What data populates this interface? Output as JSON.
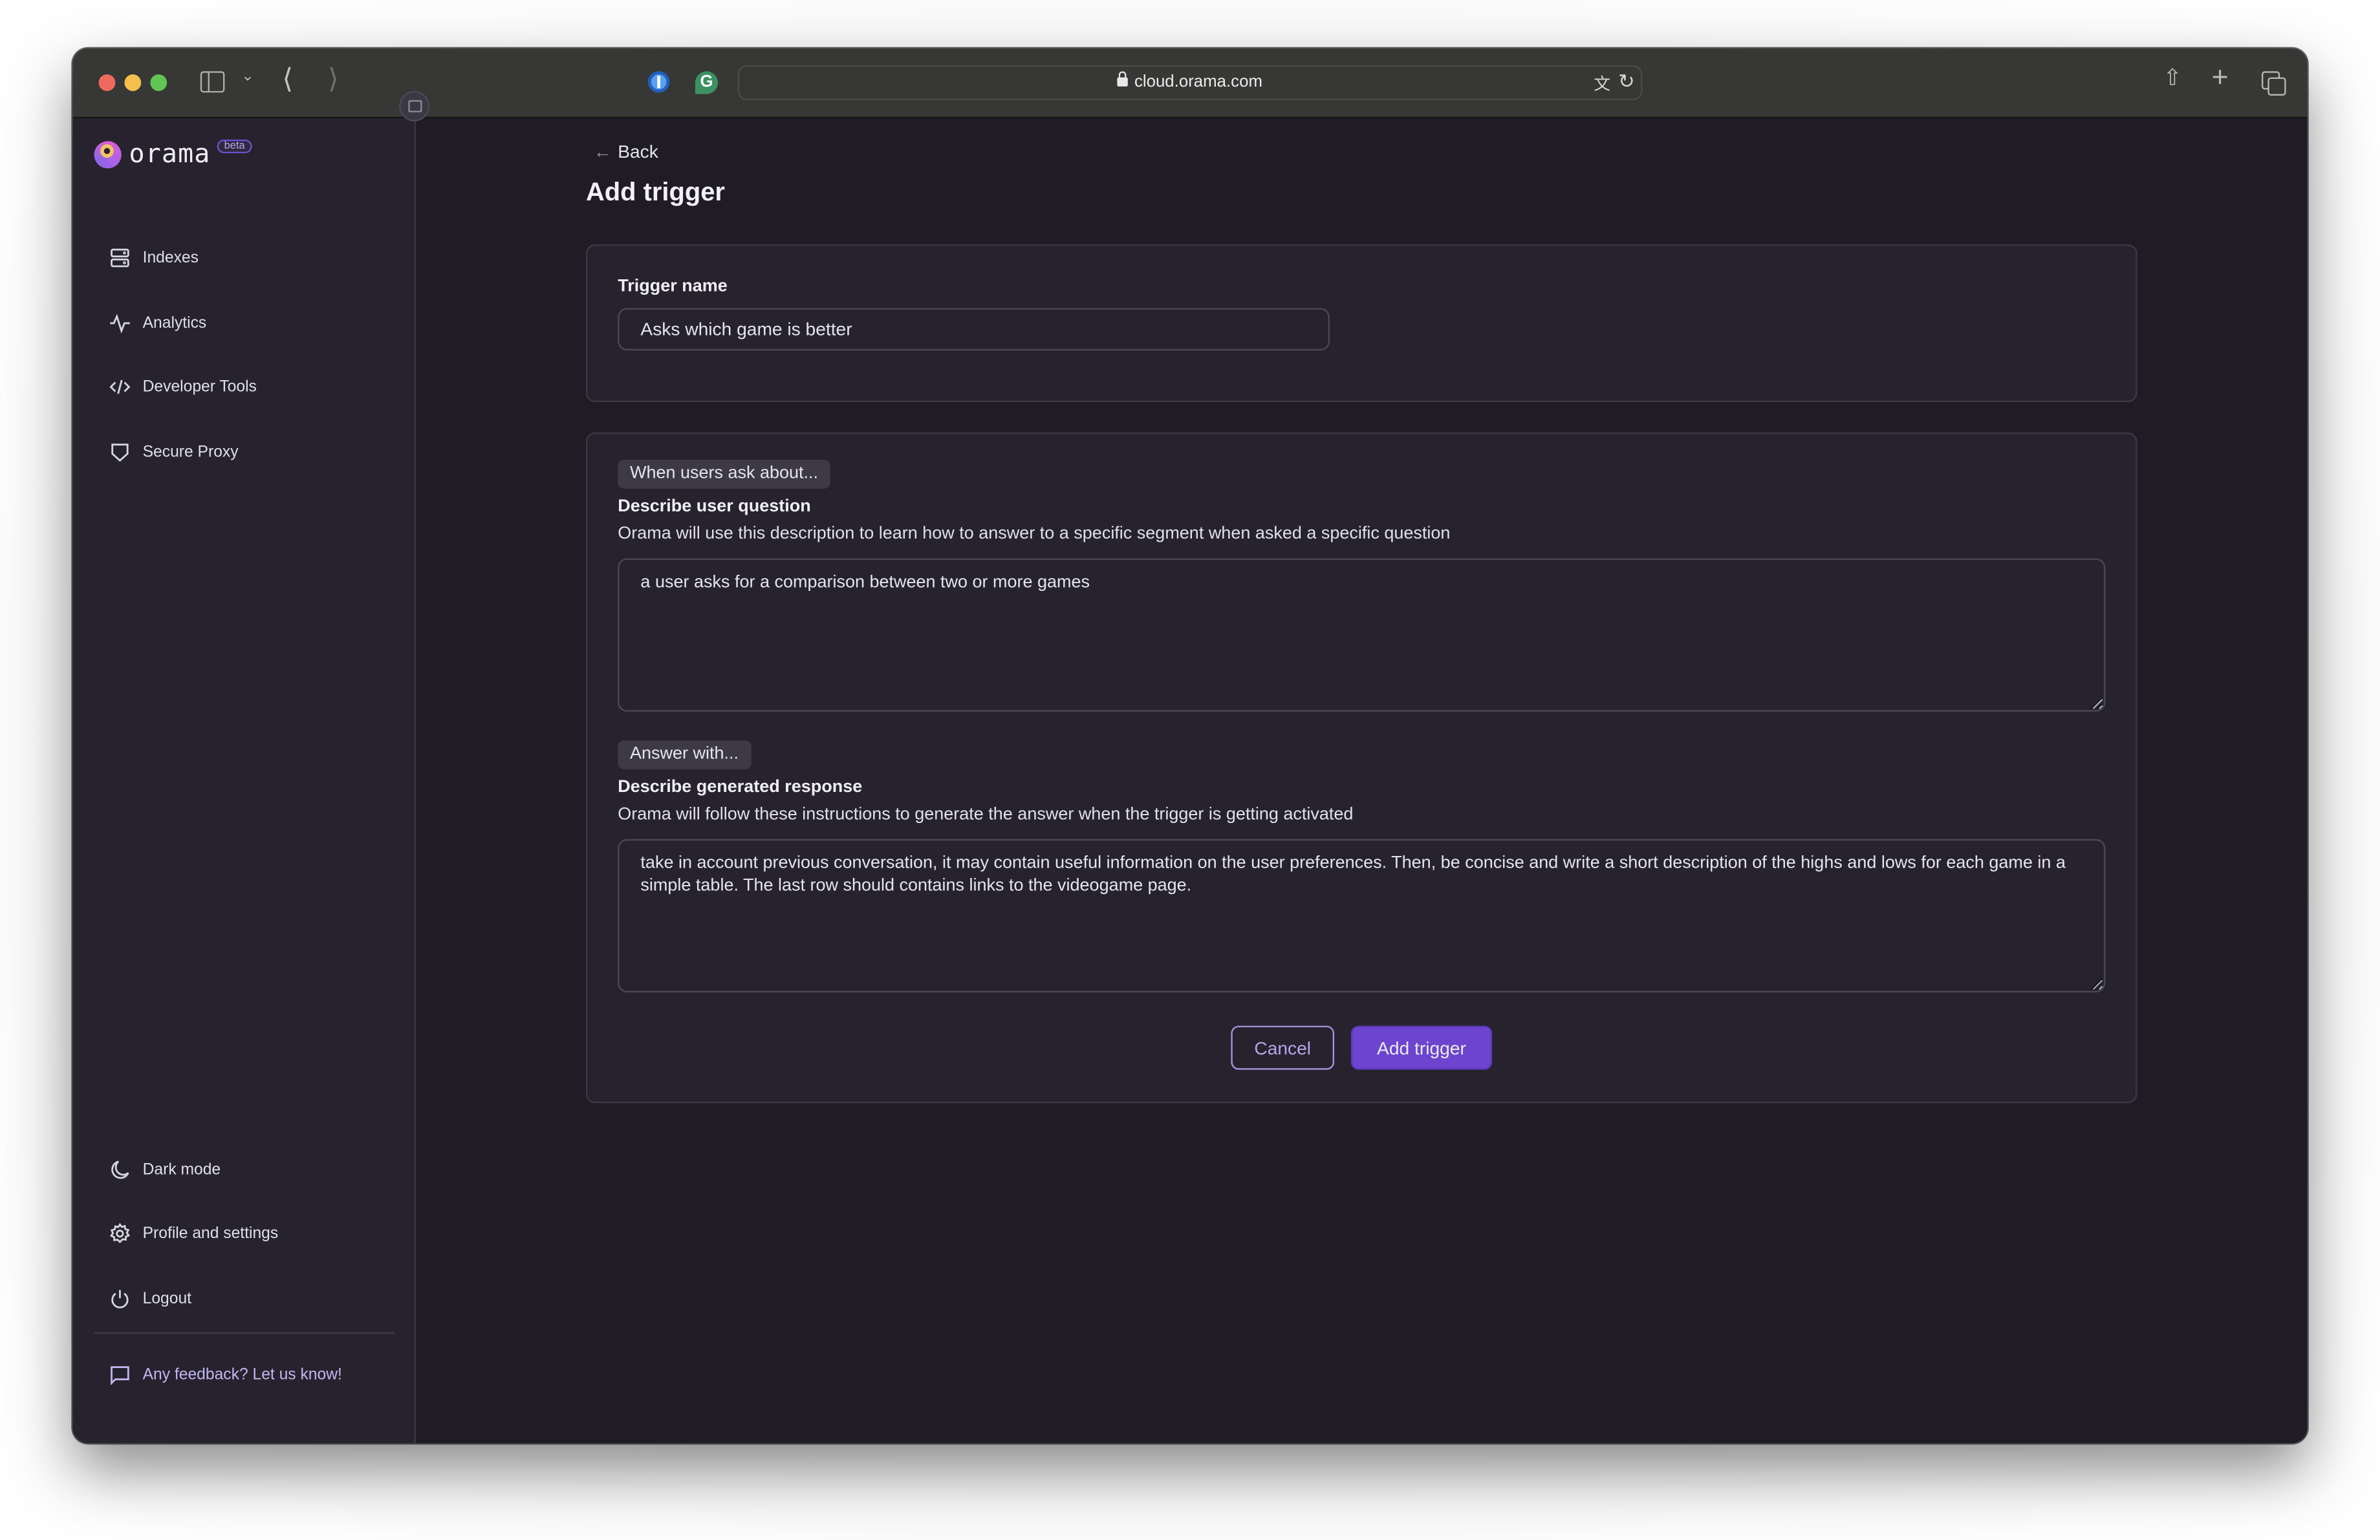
{
  "browser": {
    "url": "cloud.orama.com",
    "icons": {
      "sidebar_toggle": "sidebar-icon",
      "back": "chevron-left-icon",
      "forward": "chevron-right-icon",
      "extension_1": "1password-icon",
      "extension_2": "grammarly-icon",
      "translate": "translate-icon",
      "reload": "reload-icon",
      "share": "share-icon",
      "new_tab": "plus-icon",
      "tabs": "tabs-overview-icon"
    }
  },
  "sidebar": {
    "logo_text": "orama",
    "beta_badge": "beta",
    "nav_items": [
      {
        "label": "Indexes",
        "icon": "server-icon"
      },
      {
        "label": "Analytics",
        "icon": "activity-icon"
      },
      {
        "label": "Developer Tools",
        "icon": "code-icon"
      },
      {
        "label": "Secure Proxy",
        "icon": "shield-icon"
      }
    ],
    "bottom_items": [
      {
        "label": "Dark mode",
        "icon": "moon-icon"
      },
      {
        "label": "Profile and settings",
        "icon": "gear-icon"
      },
      {
        "label": "Logout",
        "icon": "power-icon"
      }
    ],
    "feedback": {
      "label": "Any feedback? Let us know!",
      "icon": "message-icon"
    }
  },
  "main": {
    "back_label": "Back",
    "title": "Add trigger",
    "trigger_name": {
      "label": "Trigger name",
      "value": "Asks which game is better"
    },
    "question_section": {
      "chip": "When users ask about...",
      "label": "Describe user question",
      "helper": "Orama will use this description to learn how to answer to a specific segment when asked a specific question",
      "value": "a user asks for a comparison between two or more games"
    },
    "response_section": {
      "chip": "Answer with...",
      "label": "Describe generated response",
      "helper": "Orama will follow these instructions to generate the answer when the trigger is getting activated",
      "value": "take in account previous conversation, it may contain useful information on the user preferences. Then, be concise and write a short description of the highs and lows for each game in a simple table. The last row should contains links to the videogame page."
    },
    "buttons": {
      "cancel": "Cancel",
      "submit": "Add trigger"
    }
  },
  "colors": {
    "accent": "#6c44cf",
    "accent_outline": "#a794e0",
    "background": "#1f1c26",
    "surface": "#26232e"
  }
}
